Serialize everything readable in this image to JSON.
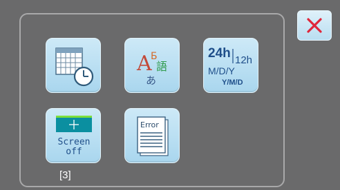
{
  "close_button": {
    "icon": "close-x-icon",
    "color": "#e0263a"
  },
  "tiles": {
    "date_time": {
      "icon": "calendar-clock-icon"
    },
    "language": {
      "icon": "language-icon",
      "glyphs": [
        "A",
        "Б",
        "語",
        "あ"
      ]
    },
    "date_format": {
      "hour24": "24h",
      "hour12": "12h",
      "mdy": "M/D/Y",
      "ymd": "Y/M/D"
    },
    "screen_off": {
      "icon": "screen-off-icon",
      "line1": "Screen",
      "line2": "off"
    },
    "error_log": {
      "icon": "error-document-icon",
      "title": "Error"
    }
  },
  "page_indicator": "[3]"
}
